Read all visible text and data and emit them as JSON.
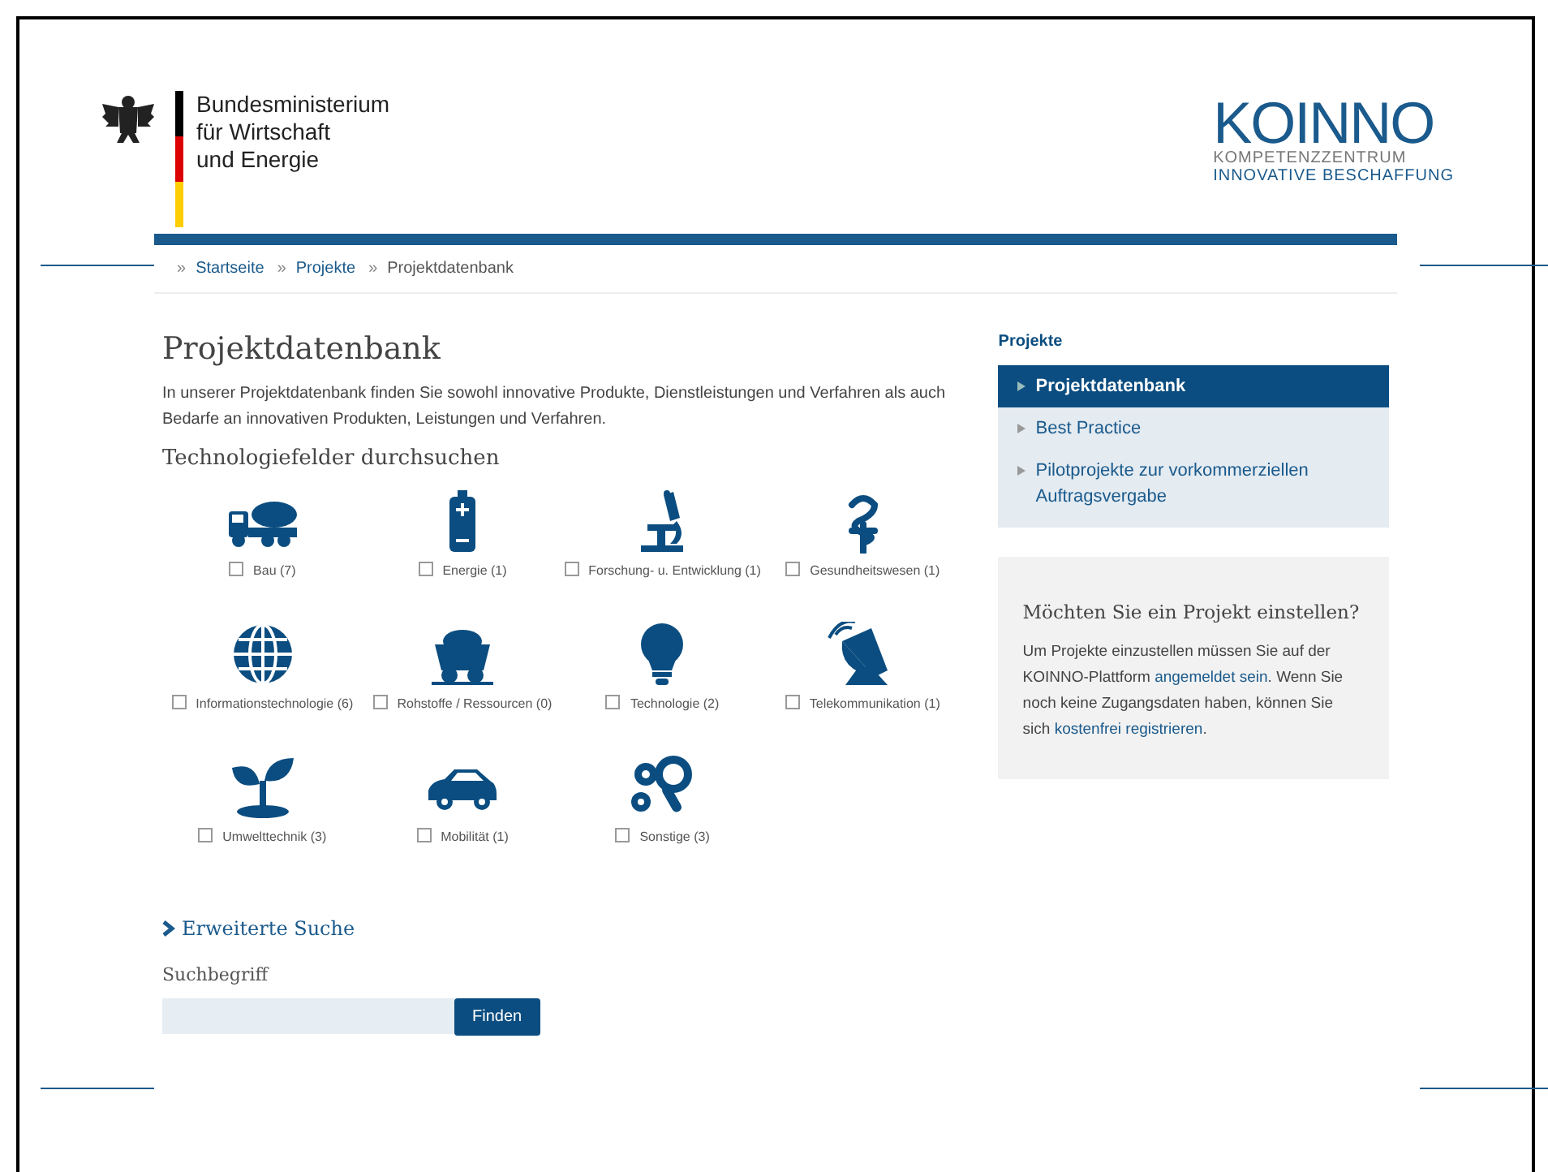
{
  "header": {
    "ministry_lines": [
      "Bundesministerium",
      "für Wirtschaft",
      "und Energie"
    ],
    "logo": {
      "name": "KOINNO",
      "lines": [
        "KOMPETENZZENTRUM",
        "INNOVATIVE BESCHAFFUNG"
      ]
    }
  },
  "breadcrumb": [
    {
      "marker": "»",
      "label": "Startseite",
      "current": false
    },
    {
      "marker": "»",
      "label": "Projekte",
      "current": false
    },
    {
      "marker": "»",
      "label": "Projektdatenbank",
      "current": true
    }
  ],
  "main": {
    "title": "Projektdatenbank",
    "intro": "In unserer Projektdatenbank finden Sie sowohl innovative Produkte, Dienstleistungen und Verfahren als auch Bedarfe an innovativen Produkten, Leistungen und Verfahren.",
    "section_title": "Technologiefelder durchsuchen",
    "fields": [
      {
        "label": "Bau (7)",
        "checked": false
      },
      {
        "label": "Energie (1)",
        "checked": false
      },
      {
        "label": "Forschung- u. Entwicklung (1)",
        "checked": false
      },
      {
        "label": "Gesundheitswesen (1)",
        "checked": false
      },
      {
        "label": "Informationstechnologie (6)",
        "checked": false
      },
      {
        "label": "Rohstoffe / Ressourcen (0)",
        "checked": false
      },
      {
        "label": "Technologie (2)",
        "checked": false
      },
      {
        "label": "Telekommunikation (1)",
        "checked": false
      },
      {
        "label": "Umwelttechnik (3)",
        "checked": false
      },
      {
        "label": "Mobilität (1)",
        "checked": false
      },
      {
        "label": "Sonstige (3)",
        "checked": false
      }
    ],
    "advanced_search": {
      "label": "Erweiterte Suche",
      "expanded": false
    },
    "search": {
      "label": "Suchbegriff",
      "button": "Finden"
    }
  },
  "sidebar": {
    "title": "Projekte",
    "items": [
      {
        "label": "Projektdatenbank",
        "selected": true
      },
      {
        "label": "Best Practice",
        "selected": false
      },
      {
        "label": "Pilotprojekte zur vorkommerziellen Auftragsvergabe",
        "selected": false
      }
    ],
    "info_box": {
      "title": "Möchten Sie ein Projekt einstellen?",
      "parts": [
        {
          "kind": "text",
          "text": "Um Projekte einzustellen müssen Sie auf der KOINNO-Plattform "
        },
        {
          "kind": "link",
          "text": "angemeldet sein"
        },
        {
          "kind": "text",
          "text": ". Wenn Sie noch keine Zugangsdaten haben, können Sie sich "
        },
        {
          "kind": "link",
          "text": "kostenfrei registrieren"
        },
        {
          "kind": "text",
          "text": "."
        }
      ]
    }
  }
}
